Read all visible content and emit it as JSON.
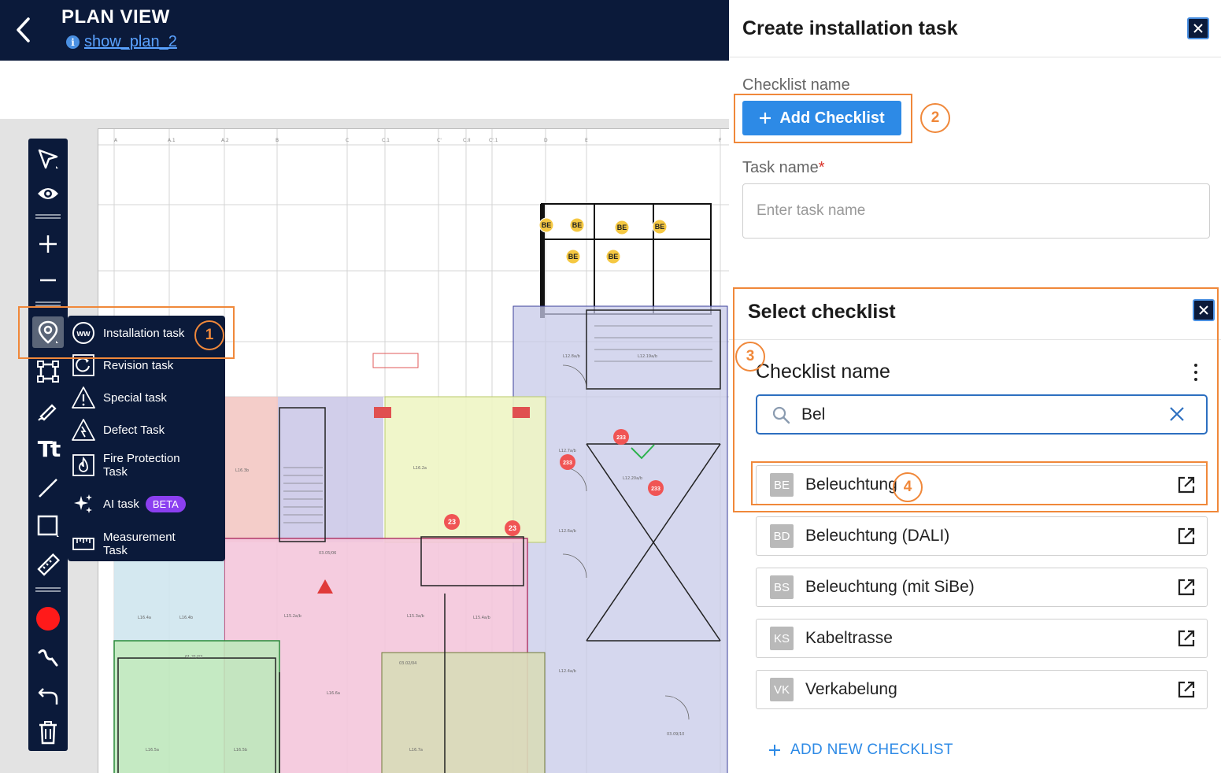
{
  "header": {
    "title": "PLAN VIEW",
    "plan_link": "show_plan_2",
    "info_glyph": "i"
  },
  "toolbar": {
    "tools": [
      "select-arrow-icon",
      "eye-icon",
      "zoom-in-icon",
      "zoom-out-icon",
      "location-pin-icon",
      "area-icon",
      "pen-icon",
      "text-icon",
      "line-icon",
      "rectangle-icon",
      "ruler-icon",
      "color-dot-icon",
      "freehand-icon",
      "undo-icon",
      "trash-icon"
    ],
    "active_color": "#ff1a1a",
    "text_tool_glyph": "Tt"
  },
  "task_menu": {
    "items": [
      {
        "label": "Installation task",
        "icon": "installation-ww-icon",
        "icon_text": "ww"
      },
      {
        "label": "Revision task",
        "icon": "revision-icon"
      },
      {
        "label": "Special task",
        "icon": "warning-triangle-icon"
      },
      {
        "label": "Defect Task",
        "icon": "defect-triangle-icon"
      },
      {
        "label": "Fire Protection Task",
        "icon": "fire-icon"
      },
      {
        "label": "AI task",
        "icon": "sparkle-icon",
        "badge": "BETA"
      },
      {
        "label": "Measurement Task",
        "icon": "ruler-icon"
      }
    ]
  },
  "steps": [
    "1",
    "2",
    "3",
    "4"
  ],
  "panel": {
    "title": "Create installation task",
    "checklist_name_label": "Checklist name",
    "add_checklist_label": "Add Checklist",
    "task_name_label": "Task name",
    "required_mark": "*",
    "task_name_placeholder": "Enter task name",
    "task_name_value": ""
  },
  "select_checklist": {
    "title": "Select checklist",
    "heading": "Checklist name",
    "search_value": "Bel",
    "items": [
      {
        "badge": "BE",
        "label": "Beleuchtung"
      },
      {
        "badge": "BD",
        "label": "Beleuchtung (DALI)"
      },
      {
        "badge": "BS",
        "label": "Beleuchtung (mit SiBe)"
      },
      {
        "badge": "KS",
        "label": "Kabeltrasse"
      },
      {
        "badge": "VK",
        "label": "Verkabelung"
      }
    ],
    "add_new_label": "ADD NEW CHECKLIST"
  },
  "plan": {
    "markers": [
      {
        "type": "BE",
        "color": "#f5c842"
      },
      {
        "type": "233",
        "color": "#f05454"
      },
      {
        "type": "23",
        "color": "#f05454"
      }
    ],
    "marker_labels": {
      "be": "BE",
      "r233": "233",
      "r23": "23"
    },
    "zone_colors": {
      "red": "#f2c4c0",
      "purple": "#c9c6e6",
      "yellow": "#eef5c4",
      "pink": "#f4c6dc",
      "lightblue": "#cfe6ee",
      "green": "#bfe8bd",
      "olive": "#d8dcb8",
      "lavender": "#c7c9e8"
    }
  }
}
